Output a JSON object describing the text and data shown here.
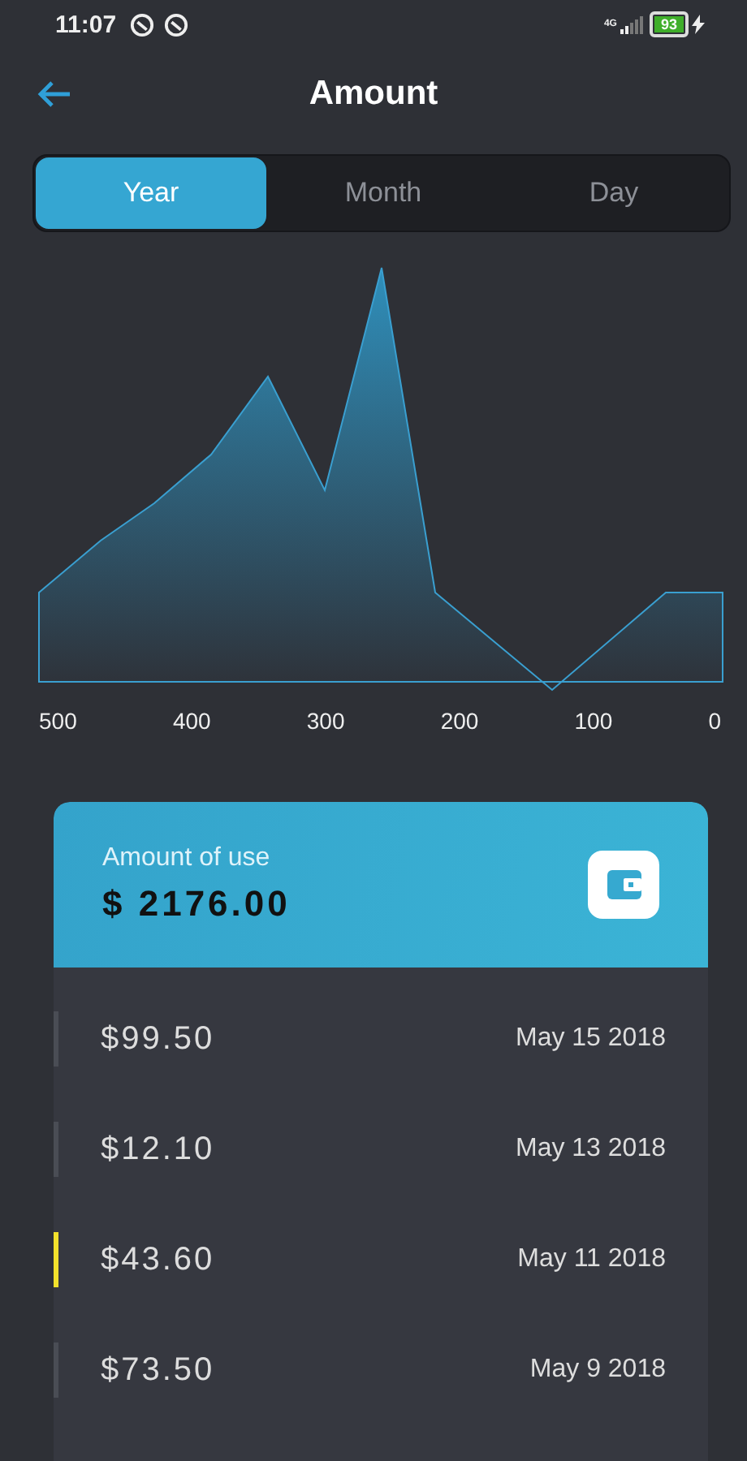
{
  "status_bar": {
    "time": "11:07",
    "network": "4G",
    "battery": "93"
  },
  "header": {
    "title": "Amount"
  },
  "tabs": [
    {
      "label": "Year",
      "selected": true
    },
    {
      "label": "Month",
      "selected": false
    },
    {
      "label": "Day",
      "selected": false
    }
  ],
  "chart": {
    "axis_labels": [
      "500",
      "400",
      "300",
      "200",
      "100",
      "0"
    ]
  },
  "summary": {
    "label": "Amount of use",
    "total": "$ 2176.00"
  },
  "transactions": [
    {
      "amount": "$99.50",
      "date": "May 15 2018",
      "color": "#4a4d55"
    },
    {
      "amount": "$12.10",
      "date": "May 13 2018",
      "color": "#4a4d55"
    },
    {
      "amount": "$43.60",
      "date": "May 11 2018",
      "color": "#f2e12c"
    },
    {
      "amount": "$73.50",
      "date": "May 9 2018",
      "color": "#4a4d55"
    }
  ]
}
